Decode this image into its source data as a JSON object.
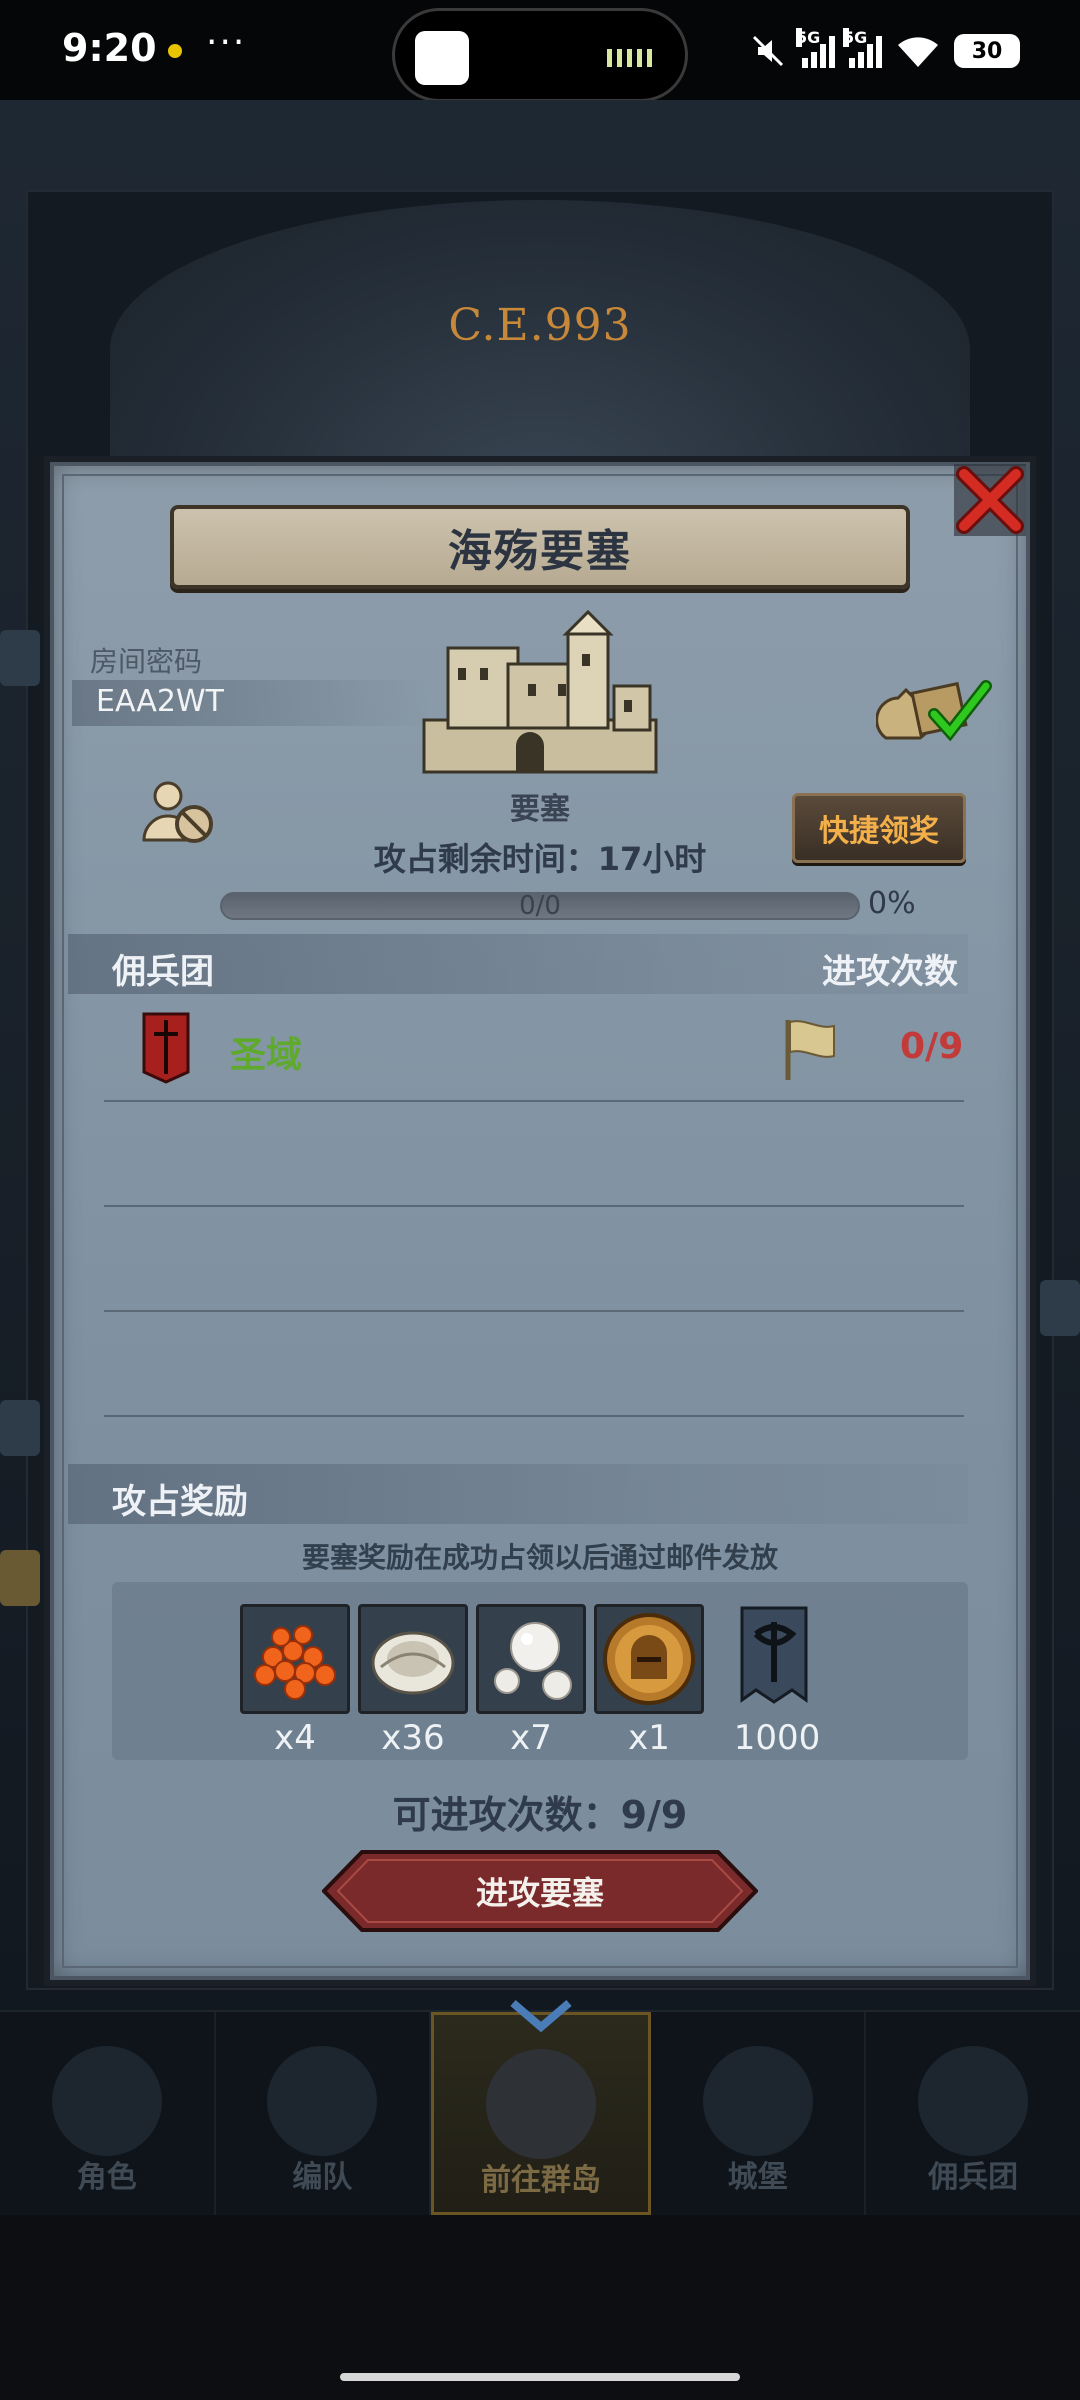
{
  "status_bar": {
    "time": "9:20",
    "more": "···",
    "signal1_label": "5G",
    "signal2_label": "5G",
    "battery": "30"
  },
  "background": {
    "era_label": "C.E.993"
  },
  "dialog": {
    "title": "海殇要塞",
    "room": {
      "label": "房间密码",
      "code": "EAA2WT"
    },
    "fortress_label": "要塞",
    "quick_claim_label": "快捷领奖",
    "remaining_time": "攻占剩余时间：17小时",
    "progress": {
      "text": "0/0",
      "percent_text": "0%",
      "fraction": 0
    },
    "guild_section": {
      "title": "佣兵团",
      "right_title": "进攻次数"
    },
    "guild_rows": [
      {
        "name": "圣域",
        "attacks": "0/9"
      }
    ],
    "reward_section": {
      "title": "攻占奖励",
      "note": "要塞奖励在成功占领以后通过邮件发放"
    },
    "rewards": [
      {
        "icon": "fish-roe-icon",
        "count": "x4"
      },
      {
        "icon": "oyster-icon",
        "count": "x36"
      },
      {
        "icon": "pearl-icon",
        "count": "x7"
      },
      {
        "icon": "knight-helmet-coin-icon",
        "count": "x1"
      },
      {
        "icon": "guild-banner-icon",
        "count": "1000"
      }
    ],
    "attacks_available": "可进攻次数：9/9",
    "attack_button_label": "进攻要塞"
  },
  "nav": {
    "items": [
      {
        "label": "角色",
        "icon": "character-icon"
      },
      {
        "label": "编队",
        "icon": "formation-icon"
      },
      {
        "label": "前往群岛",
        "icon": "islands-icon"
      },
      {
        "label": "城堡",
        "icon": "castle-icon"
      },
      {
        "label": "佣兵团",
        "icon": "mercenary-icon"
      }
    ],
    "active": "前往群岛"
  },
  "colors": {
    "guild_name": "#5fa92c",
    "attack_count": "#c23a3a",
    "quick_btn_text": "#f3b04a",
    "attack_button": "#7a2a2a"
  }
}
